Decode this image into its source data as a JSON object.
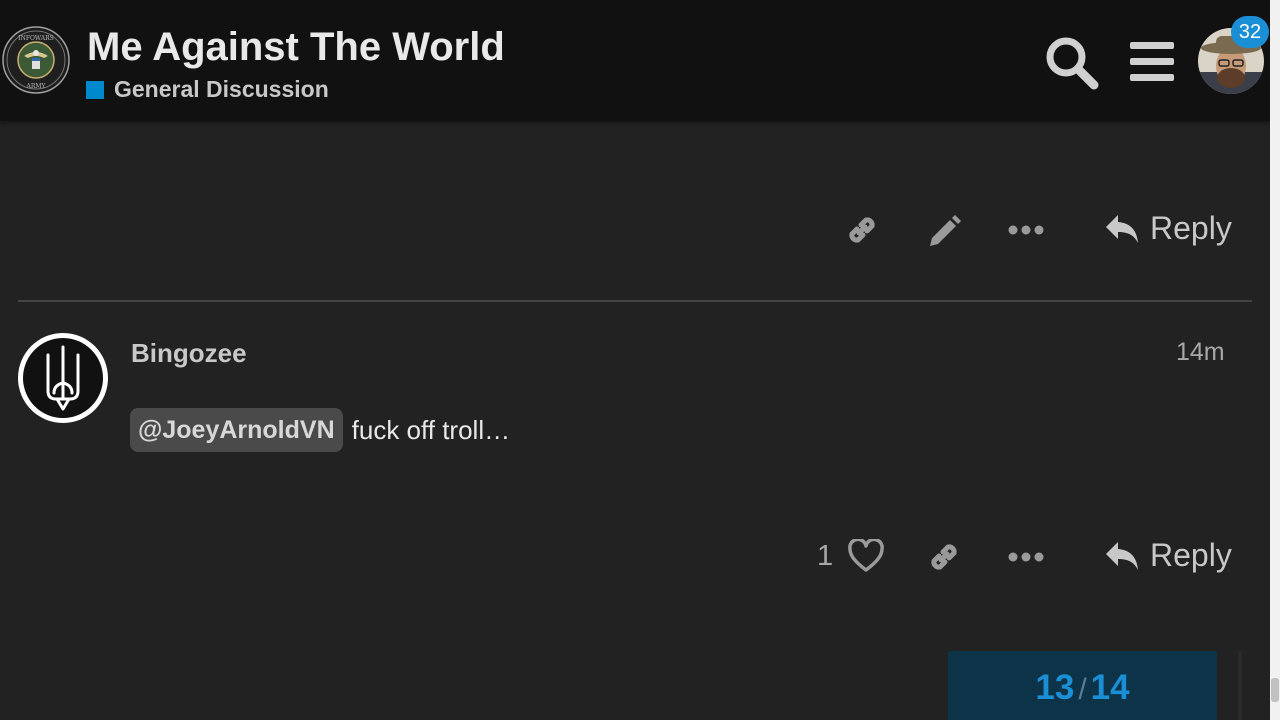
{
  "header": {
    "title": "Me Against The World",
    "category": {
      "name": "General Discussion",
      "color": "#0088cc"
    },
    "notification_count": "32"
  },
  "site_logo": {
    "text_top": "INFOWARS",
    "text_bottom": "ARMY"
  },
  "icons": {
    "search": "search-icon",
    "menu": "hamburger-icon",
    "link": "link-icon",
    "edit": "pencil-icon",
    "more": "ellipsis-icon",
    "reply": "reply-icon",
    "like": "heart-icon"
  },
  "previous_post": {
    "reply_label": "Reply"
  },
  "post": {
    "username": "Bingozee",
    "date": "14m",
    "mention": "@JoeyArnoldVN",
    "text": "fuck off troll…",
    "like_count": "1",
    "reply_label": "Reply"
  },
  "timeline": {
    "current": "13",
    "separator": "/",
    "total": "14"
  },
  "colors": {
    "accent": "#1a8fd6",
    "background": "#222222",
    "header_bg": "#111111"
  }
}
